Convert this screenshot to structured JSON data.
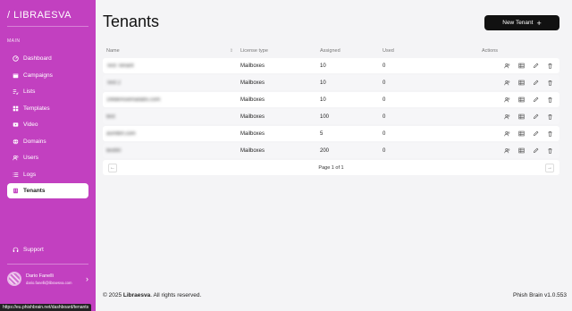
{
  "sidebar": {
    "logo": "/ LIBRAESVA",
    "section_label": "MAIN",
    "items": [
      {
        "label": "Dashboard",
        "icon": "dashboard-icon"
      },
      {
        "label": "Campaigns",
        "icon": "calendar-icon"
      },
      {
        "label": "Lists",
        "icon": "list-check-icon"
      },
      {
        "label": "Templates",
        "icon": "template-icon"
      },
      {
        "label": "Video",
        "icon": "video-icon"
      },
      {
        "label": "Domains",
        "icon": "globe-icon"
      },
      {
        "label": "Users",
        "icon": "users-icon"
      },
      {
        "label": "Logs",
        "icon": "logs-icon"
      },
      {
        "label": "Tenants",
        "icon": "building-icon",
        "active": true
      }
    ],
    "support_label": "Support",
    "user": {
      "name": "Dario Fanelli",
      "email": "dario.fanelli@libraesva.com"
    }
  },
  "main": {
    "title": "Tenants",
    "new_button": "New Tenant",
    "columns": {
      "name": "Name",
      "license": "License type",
      "assigned": "Assigned",
      "used": "Used",
      "actions": "Actions"
    },
    "rows": [
      {
        "name": "Test Tenant",
        "license": "Mailboxes",
        "assigned": "10",
        "used": "0"
      },
      {
        "name": "Test 2",
        "license": "Mailboxes",
        "assigned": "10",
        "used": "0"
      },
      {
        "name": "1Mdemoemailabs.com",
        "license": "Mailboxes",
        "assigned": "10",
        "used": "0"
      },
      {
        "name": "test",
        "license": "Mailboxes",
        "assigned": "100",
        "used": "0"
      },
      {
        "name": "asmlbrt.com",
        "license": "Mailboxes",
        "assigned": "5",
        "used": "0"
      },
      {
        "name": "test90",
        "license": "Mailboxes",
        "assigned": "200",
        "used": "0"
      }
    ],
    "pagination": "Page 1 of 1"
  },
  "footer": {
    "copyright_prefix": "© 2025 ",
    "brand": "Libraesva",
    "copyright_suffix": ". All rights reserved.",
    "version": "Phish Brain v1.0.553"
  },
  "status_url": "https://eu.phishbrain.net/dashboard/tenants"
}
